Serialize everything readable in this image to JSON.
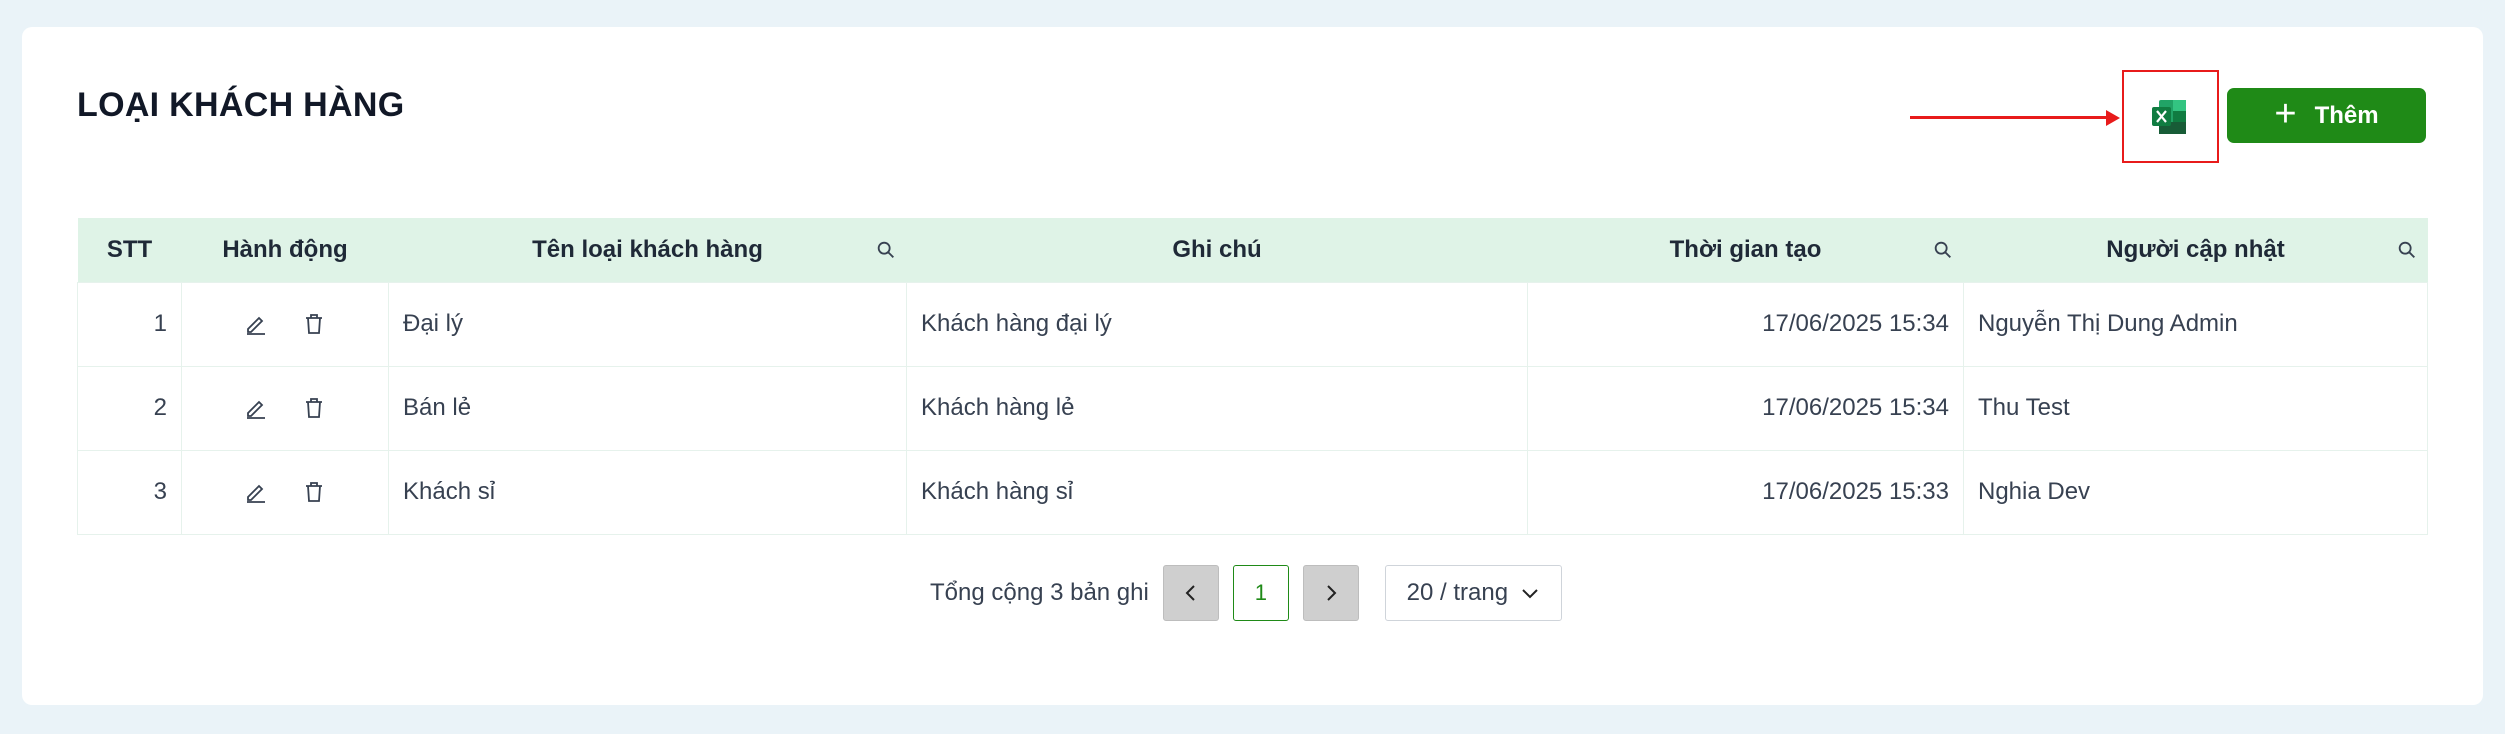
{
  "page": {
    "title": "LOẠI KHÁCH HÀNG",
    "export_icon": "excel-icon",
    "add_label": "Thêm"
  },
  "table": {
    "headers": [
      "STT",
      "Hành động",
      "Tên loại khách hàng",
      "Ghi chú",
      "Thời gian tạo",
      "Người cập nhật"
    ],
    "rows": [
      {
        "stt": "1",
        "name": "Đại lý",
        "note": "Khách hàng đại lý",
        "created": "17/06/2025 15:34",
        "updater": "Nguyễn Thị Dung Admin"
      },
      {
        "stt": "2",
        "name": "Bán lẻ",
        "note": "Khách hàng lẻ",
        "created": "17/06/2025 15:34",
        "updater": "Thu Test"
      },
      {
        "stt": "3",
        "name": "Khách sỉ",
        "note": "Khách hàng sỉ",
        "created": "17/06/2025 15:33",
        "updater": "Nghia Dev"
      }
    ]
  },
  "pagination": {
    "total_text": "Tổng cộng 3 bản ghi",
    "current_page": "1",
    "page_size": "20 / trang"
  },
  "colors": {
    "accent": "#1f8a17",
    "header_bg": "#dff3e7",
    "annotation": "#e81b1b"
  }
}
